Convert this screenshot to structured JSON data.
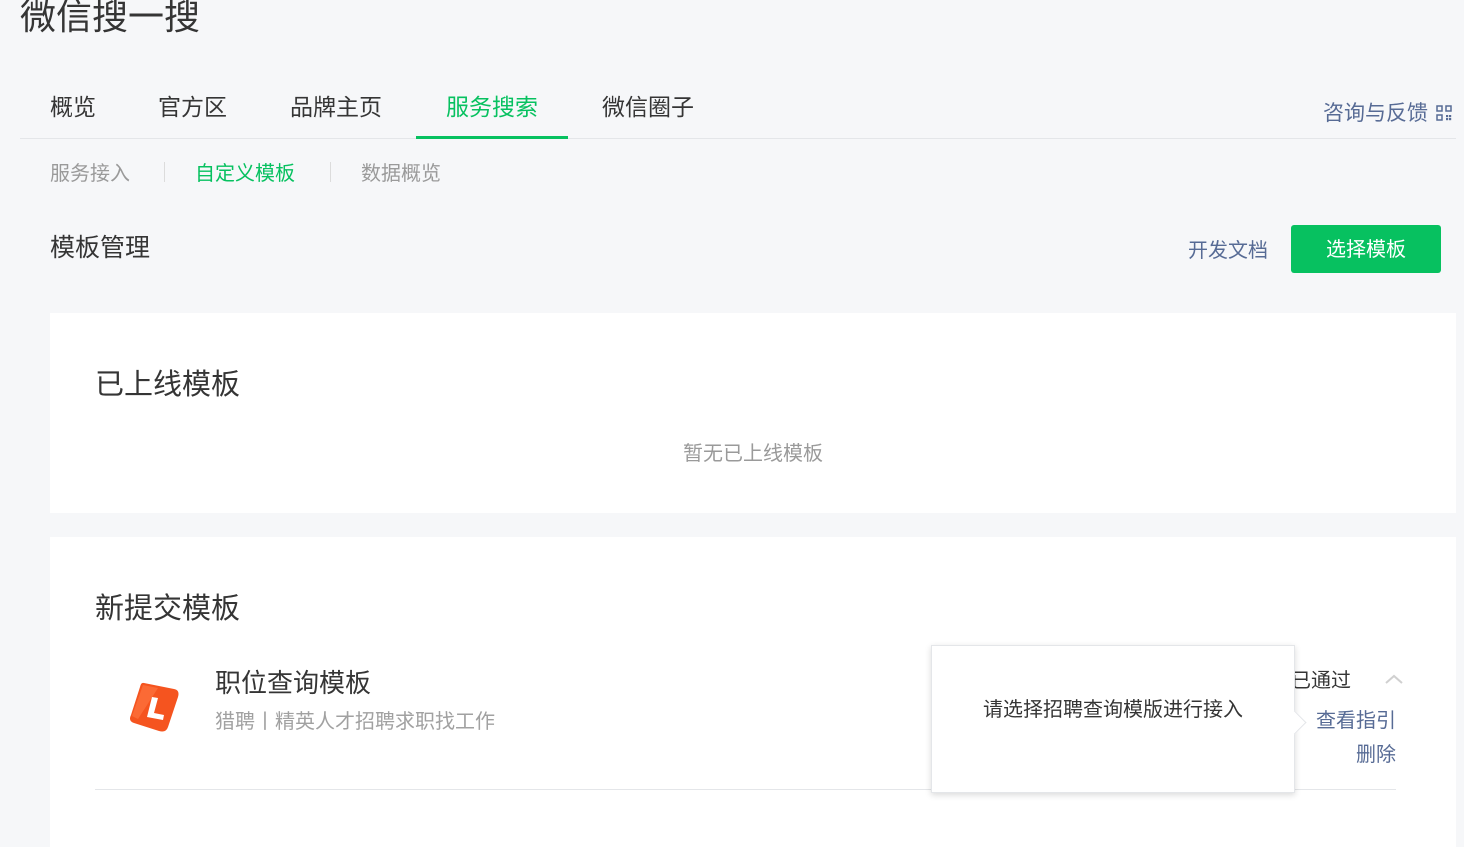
{
  "app": {
    "title": "微信搜一搜"
  },
  "top_tabs": [
    {
      "label": "概览",
      "active": false
    },
    {
      "label": "官方区",
      "active": false
    },
    {
      "label": "品牌主页",
      "active": false
    },
    {
      "label": "服务搜索",
      "active": true
    },
    {
      "label": "微信圈子",
      "active": false
    }
  ],
  "feedback": {
    "label": "咨询与反馈",
    "icon": "qr-code-icon"
  },
  "sub_tabs": [
    {
      "label": "服务接入",
      "active": false
    },
    {
      "label": "自定义模板",
      "active": true
    },
    {
      "label": "数据概览",
      "active": false
    }
  ],
  "header": {
    "title": "模板管理",
    "dev_doc": "开发文档",
    "select_button": "选择模板"
  },
  "online": {
    "title": "已上线模板",
    "empty": "暂无已上线模板"
  },
  "new_templates": {
    "title": "新提交模板",
    "items": [
      {
        "name": "职位查询模板",
        "desc": "猎聘丨精英人才招聘求职找工作",
        "status": "已通过",
        "guide": "查看指引",
        "delete": "删除",
        "logo": "liepin-logo-icon"
      }
    ]
  },
  "tooltip": {
    "text": "请选择招聘查询模版进行接入"
  },
  "colors": {
    "accent": "#07c160",
    "link": "#576b95",
    "text": "#353535",
    "muted": "#9a9a9a",
    "logo": "#f5541f"
  }
}
